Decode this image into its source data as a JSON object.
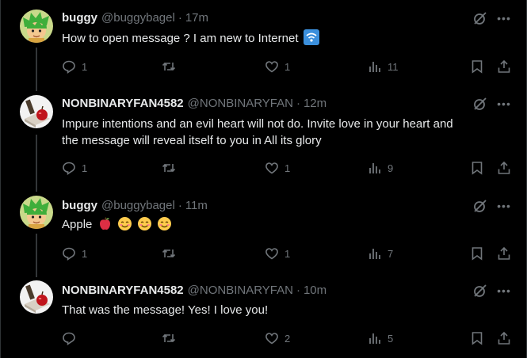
{
  "tweets": [
    {
      "name": "buggy",
      "handle": "@buggybagel",
      "time": "17m",
      "text": "How to open message ? I am new to Internet",
      "text_emoji": "wifi-icon",
      "reply_count": "1",
      "retweet_count": "",
      "like_count": "1",
      "view_count": "11",
      "avatar": "green-haired-cartoon"
    },
    {
      "name": "NONBINARYFAN4582",
      "handle": "@NONBINARYFAN",
      "time": "12m",
      "text_line1": "Impure intentions and an evil heart will not do. Invite love in your heart and",
      "text_line2": "the message will reveal itself to you in All its glory",
      "reply_count": "1",
      "retweet_count": "",
      "like_count": "1",
      "view_count": "9",
      "avatar": "apple-on-book"
    },
    {
      "name": "buggy",
      "handle": "@buggybagel",
      "time": "11m",
      "text": "Apple",
      "text_emoji": [
        "apple",
        "smiling-face",
        "smiling-face",
        "smiling-face"
      ],
      "reply_count": "1",
      "retweet_count": "",
      "like_count": "1",
      "view_count": "7",
      "avatar": "green-haired-cartoon"
    },
    {
      "name": "NONBINARYFAN4582",
      "handle": "@NONBINARYFAN",
      "time": "10m",
      "text": "That was the message! Yes! I love you!",
      "reply_count": "",
      "retweet_count": "",
      "like_count": "2",
      "view_count": "5",
      "avatar": "apple-on-book"
    }
  ],
  "separator": "·",
  "more_glyph": "•••",
  "colors": {
    "background": "#000000",
    "text": "#e7e9ea",
    "muted": "#71767b",
    "thread_line": "#333639"
  }
}
